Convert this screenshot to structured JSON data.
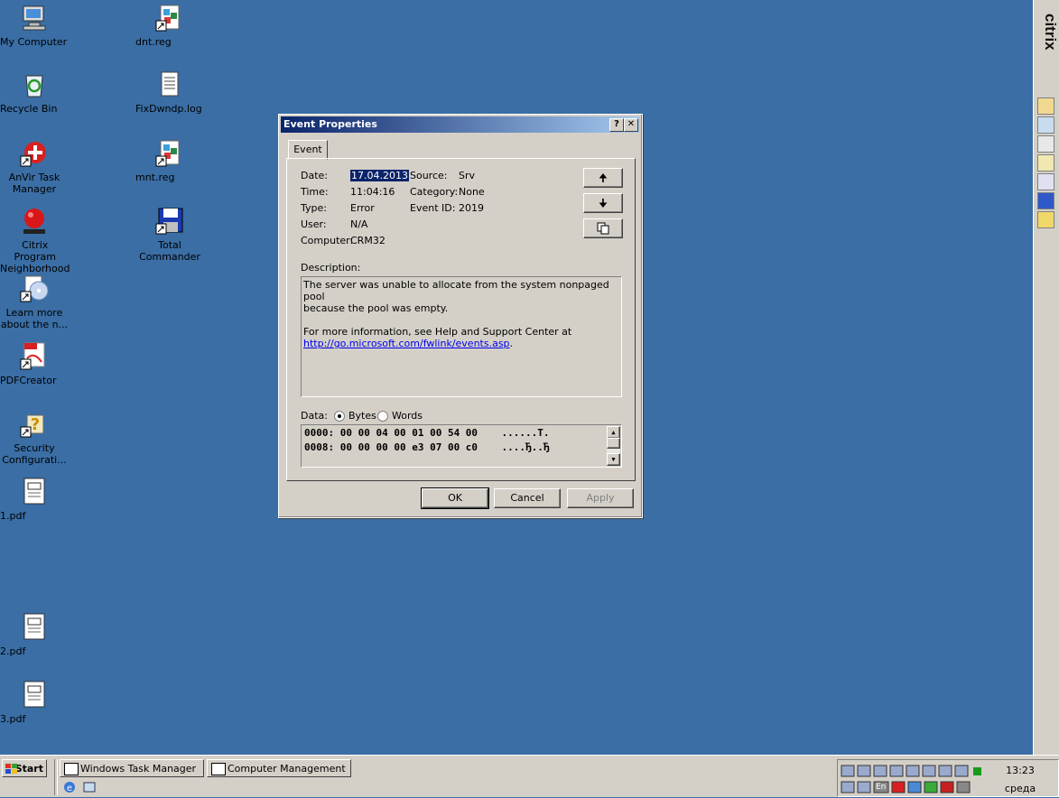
{
  "desktop": {
    "icons": [
      {
        "label": "My Computer"
      },
      {
        "label": "Recycle Bin"
      },
      {
        "label": "AnVir Task Manager"
      },
      {
        "label": "Citrix Program Neighborhood"
      },
      {
        "label": "Learn more about the n..."
      },
      {
        "label": "PDFCreator"
      },
      {
        "label": "Security Configurati..."
      },
      {
        "label": "1.pdf"
      },
      {
        "label": "2.pdf"
      },
      {
        "label": "3.pdf"
      },
      {
        "label": "dnt.reg"
      },
      {
        "label": "FixDwndp.log"
      },
      {
        "label": "mnt.reg"
      },
      {
        "label": "Total Commander"
      }
    ]
  },
  "citrix": {
    "logo": "citrix"
  },
  "dialog": {
    "title": "Event Properties",
    "help_button": "?",
    "close_button": "✕",
    "tab": "Event",
    "fields": {
      "date_label": "Date:",
      "date_value": "17.04.2013",
      "source_label": "Source:",
      "source_value": "Srv",
      "time_label": "Time:",
      "time_value": "11:04:16",
      "category_label": "Category:",
      "category_value": "None",
      "type_label": "Type:",
      "type_value": "Error",
      "eventid_label": "Event ID:",
      "eventid_value": "2019",
      "user_label": "User:",
      "user_value": "N/A",
      "computer_label": "Computer:",
      "computer_value": "CRM32"
    },
    "description_label": "Description:",
    "description_line1": "The server was unable to allocate from the system nonpaged pool",
    "description_line2": "because the pool was empty.",
    "description_line3": "For more information, see Help and Support Center at",
    "description_link": "http://go.microsoft.com/fwlink/events.asp",
    "description_link_suffix": ".",
    "data_label": "Data:",
    "bytes_label": "Bytes",
    "words_label": "Words",
    "data_rows": [
      "0000: 00 00 04 00 01 00 54 00    ......T.",
      "0008: 00 00 00 00 e3 07 00 c0    ....Ђ..Ђ"
    ],
    "ok_label": "OK",
    "cancel_label": "Cancel",
    "apply_label": "Apply",
    "up_arrow": "🠉",
    "down_arrow": "🠋",
    "copy_icon": "copy-icon"
  },
  "taskbar": {
    "start_label": "Start",
    "tasks": [
      {
        "label": "Windows Task Manager"
      },
      {
        "label": "Computer Management"
      }
    ],
    "clock": "13:23",
    "day": "среда",
    "tray_lang": "En"
  }
}
